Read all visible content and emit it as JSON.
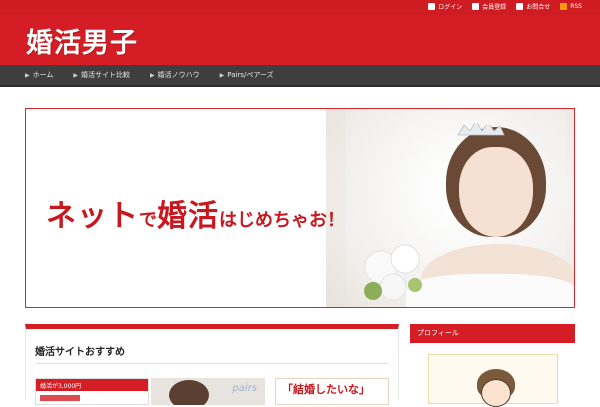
{
  "topbar": {
    "links": [
      {
        "label": "ログイン",
        "icon": "user-icon"
      },
      {
        "label": "会員登録",
        "icon": "register-icon"
      },
      {
        "label": "お問合せ",
        "icon": "mail-icon"
      },
      {
        "label": "RSS",
        "icon": "rss-icon"
      }
    ]
  },
  "header": {
    "logo": "婚活男子",
    "accent": "#d41d24"
  },
  "nav": {
    "items": [
      {
        "label": "ホーム"
      },
      {
        "label": "婚活サイト比較"
      },
      {
        "label": "婚活ノウハウ"
      },
      {
        "label": "Pairs/ペアーズ"
      }
    ]
  },
  "hero": {
    "text_1": "ネット",
    "text_2": "で",
    "text_3": "婚活",
    "text_4": "はじめちゃお！"
  },
  "main": {
    "title": "婚活サイトおすすめ",
    "cards": [
      {
        "label": "婚活が3,000円"
      },
      {
        "label": "pairs"
      },
      {
        "label": "「結婚したいな」"
      }
    ]
  },
  "sidebar": {
    "heading": "プロフィール"
  }
}
